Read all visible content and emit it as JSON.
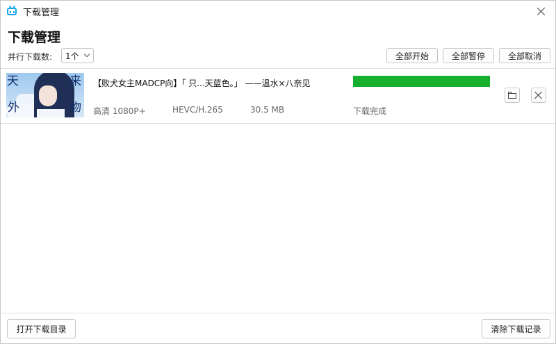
{
  "window": {
    "title": "下载管理",
    "icon": "bilibili-tv-icon",
    "close_icon": "close-icon"
  },
  "header": {
    "title": "下载管理",
    "concurrency_label": "并行下载数:",
    "concurrency_value": "1个",
    "buttons": {
      "start_all": "全部开始",
      "pause_all": "全部暂停",
      "cancel_all": "全部取消"
    }
  },
  "tasks": [
    {
      "title": "【败犬女主MADCP向】「 只...天蓝色。」 ——温水×八奈见",
      "quality": "高清 1080P+",
      "codec": "HEVC/H.265",
      "size": "30.5 MB",
      "status": "下载完成",
      "progress_percent": 100,
      "thumbnail_text": [
        "天",
        "外",
        "来",
        "物"
      ],
      "actions": {
        "open_folder_icon": "folder-icon",
        "delete_icon": "close-icon"
      }
    }
  ],
  "footer": {
    "open_dir": "打开下载目录",
    "clear_records": "清除下载记录"
  },
  "colors": {
    "progress": "#17b02e",
    "accent": "#1aa7e6"
  }
}
